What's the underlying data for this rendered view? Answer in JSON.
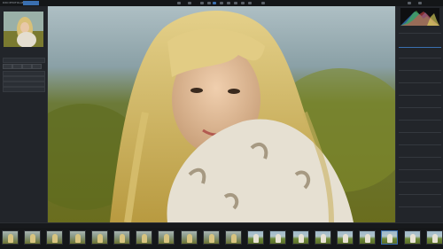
{
  "app": {
    "title": "DXO PHOTOLAB",
    "tab_library": "",
    "tab_customize": ""
  },
  "left_panel": {
    "lines": [
      "",
      "",
      "",
      "",
      ""
    ]
  },
  "right_panel": {
    "rows": [
      "",
      "",
      "",
      "",
      "",
      "",
      "",
      "",
      "",
      "",
      "",
      "",
      "",
      "",
      "",
      "",
      "",
      "",
      "",
      ""
    ]
  },
  "filmstrip": {
    "count": 20
  },
  "colors": {
    "accent": "#3a6fb0",
    "panel": "#22252a",
    "bg": "#1b1d20"
  }
}
